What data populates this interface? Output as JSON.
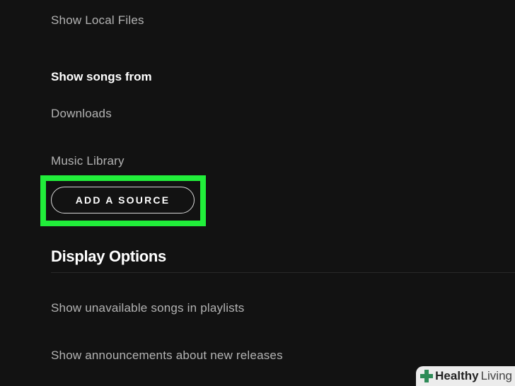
{
  "settings": {
    "show_local_files_label": "Show Local Files",
    "show_songs_from_heading": "Show songs from",
    "sources": [
      "Downloads",
      "Music Library"
    ],
    "add_source_label": "ADD A SOURCE",
    "display_options_title": "Display Options",
    "display_options": [
      "Show unavailable songs in playlists",
      "Show announcements about new releases"
    ]
  },
  "watermark": {
    "brand_bold": "Healthy",
    "brand_regular": "Living"
  },
  "colors": {
    "background": "#121212",
    "highlight": "#21ee3a",
    "muted_text": "#b3b3b3",
    "heading_text": "#ffffff"
  }
}
